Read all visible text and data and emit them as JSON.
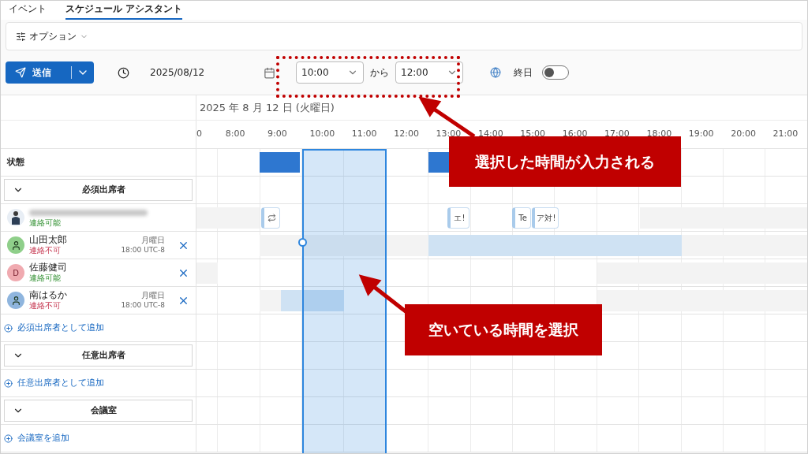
{
  "tabs": [
    {
      "label": "イベント",
      "selected": false
    },
    {
      "label": "スケジュール アシスタント",
      "selected": true
    }
  ],
  "options": {
    "label": "オプション"
  },
  "toolbar": {
    "send": "送信",
    "date": "2025/08/12",
    "start": "10:00",
    "connector": "から",
    "end": "12:00",
    "all_day": {
      "label": "終日",
      "on": false
    }
  },
  "timeline": {
    "date": "2025 年 8 月 12 日 (火曜日)",
    "hours": [
      "0",
      "8:00",
      "9:00",
      "10:00",
      "11:00",
      "12:00",
      "13:00",
      "14:00",
      "15:00",
      "16:00",
      "17:00",
      "18:00",
      "19:00",
      "20:00",
      "21:00"
    ]
  },
  "status_row": {
    "label": "状態",
    "blocks": [
      {
        "kind": "busy"
      },
      {
        "kind": "busy"
      }
    ]
  },
  "groups": [
    {
      "title": "必須出席者",
      "expanded": true,
      "add_link": "必須出席者として追加",
      "attendees": [
        {
          "avatar": {
            "kind": "photo",
            "color": "#e8eef5"
          },
          "available": true,
          "status": "連絡可能",
          "chips": [
            {
              "kind": "recurring"
            },
            {
              "kind": "text",
              "label": "エ!"
            },
            {
              "kind": "text",
              "label": "Te"
            },
            {
              "kind": "text",
              "label": "ア対!"
            }
          ],
          "blocks": [
            {
              "kind": "off"
            },
            {
              "kind": "off"
            }
          ]
        },
        {
          "avatar": {
            "kind": "person",
            "color": "#8fcf8a"
          },
          "name": "山田太郎",
          "available": false,
          "status": "連絡不可",
          "day": "月曜日",
          "time": "18:00 UTC-8",
          "blocks": [
            {
              "kind": "off"
            },
            {
              "kind": "busy"
            },
            {
              "kind": "off"
            }
          ]
        },
        {
          "avatar": {
            "kind": "initial",
            "initial": "D",
            "color": "#f0aab0"
          },
          "name": "佐藤健司",
          "available": true,
          "status": "連絡可能",
          "blocks": [
            {
              "kind": "off"
            },
            {
              "kind": "off"
            }
          ]
        },
        {
          "avatar": {
            "kind": "person",
            "color": "#8fb5de"
          },
          "name": "南はるか",
          "available": false,
          "status": "連絡不可",
          "day": "月曜日",
          "time": "18:00 UTC-8",
          "blocks": [
            {
              "kind": "off"
            },
            {
              "kind": "busy"
            },
            {
              "kind": "off"
            }
          ]
        }
      ]
    },
    {
      "title": "任意出席者",
      "expanded": true,
      "add_link": "任意出席者として追加"
    },
    {
      "title": "会議室",
      "expanded": true,
      "add_link": "会議室を追加"
    }
  ],
  "annotations": [
    {
      "text": "選択した時間が入力される"
    },
    {
      "text": "空いている時間を選択"
    }
  ]
}
